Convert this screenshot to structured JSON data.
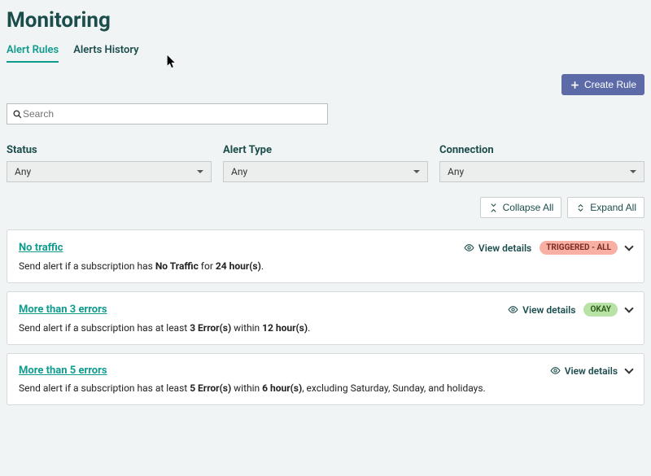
{
  "page": {
    "title": "Monitoring"
  },
  "tabs": {
    "alert_rules": "Alert Rules",
    "alerts_history": "Alerts History"
  },
  "actions": {
    "create_rule": "Create Rule"
  },
  "search": {
    "placeholder": "Search"
  },
  "filters": {
    "status": {
      "label": "Status",
      "value": "Any"
    },
    "type": {
      "label": "Alert Type",
      "value": "Any"
    },
    "conn": {
      "label": "Connection",
      "value": "Any"
    }
  },
  "toolbar": {
    "collapse_all": "Collapse All",
    "expand_all": "Expand All"
  },
  "common": {
    "view_details": "View details"
  },
  "badges": {
    "triggered_all": "TRIGGERED - ALL",
    "okay": "OKAY"
  },
  "rules": {
    "r0": {
      "title": "No traffic",
      "desc_prefix": "Send alert if a subscription has ",
      "desc_bold1": "No Traffic",
      "desc_mid": " for ",
      "desc_bold2": "24 hour(s)",
      "desc_suffix": "."
    },
    "r1": {
      "title": "More than 3 errors",
      "desc_prefix": "Send alert if a subscription has at least ",
      "desc_bold1": "3 Error(s)",
      "desc_mid": " within ",
      "desc_bold2": "12 hour(s)",
      "desc_suffix": "."
    },
    "r2": {
      "title": "More than 5 errors",
      "desc_prefix": "Send alert if a subscription has at least ",
      "desc_bold1": "5 Error(s)",
      "desc_mid": " within ",
      "desc_bold2": "6 hour(s)",
      "desc_suffix": ", excluding Saturday, Sunday, and holidays."
    }
  }
}
